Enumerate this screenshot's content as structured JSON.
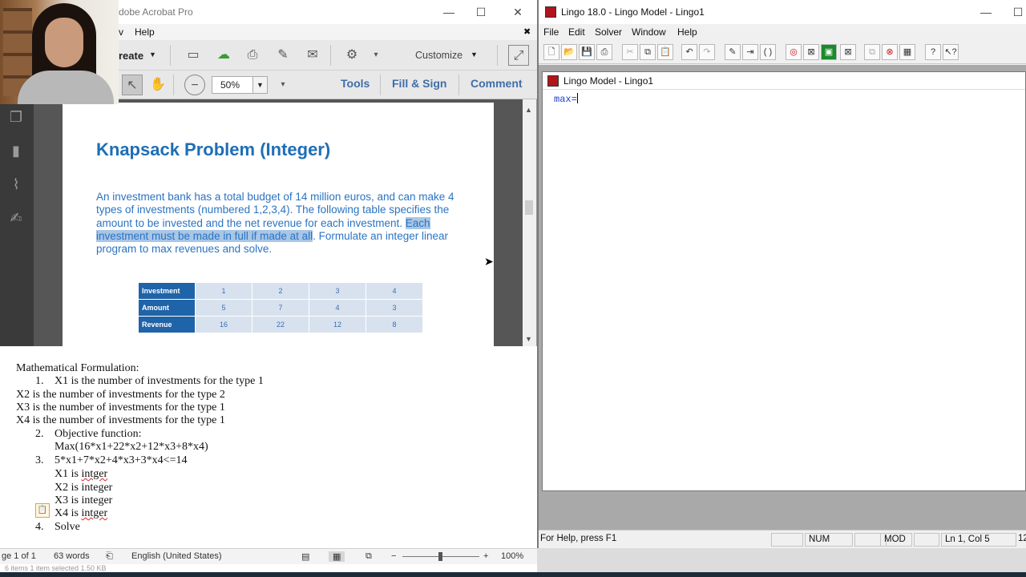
{
  "acrobat": {
    "title": "dobe Acrobat Pro",
    "menu": [
      "v",
      "Help"
    ],
    "toolbar1": {
      "create_label": "reate",
      "customize_label": "Customize"
    },
    "toolbar2": {
      "zoom_value": "50%",
      "tools_label": "Tools",
      "fill_sign_label": "Fill & Sign",
      "comment_label": "Comment"
    },
    "page": {
      "heading": "Knapsack Problem (Integer)",
      "para_before": "An investment bank has a total budget of 14 million euros, and can make 4 types of investments (numbered 1,2,3,4). The following table specifies the amount to be invested and the net revenue for each investment. ",
      "para_highlight": "Each investment must be made in full if made at all",
      "para_after": ". Formulate an integer linear program to max revenues and solve.",
      "table": {
        "rows": [
          {
            "header": "Investment",
            "cells": [
              "1",
              "2",
              "3",
              "4"
            ]
          },
          {
            "header": "Amount",
            "cells": [
              "5",
              "7",
              "4",
              "3"
            ]
          },
          {
            "header": "Revenue",
            "cells": [
              "16",
              "22",
              "12",
              "8"
            ]
          }
        ]
      }
    }
  },
  "word": {
    "lines": [
      "Mathematical Formulation:",
      "1.",
      "X1 is the number of investments for the type 1",
      "X2 is the number of investments for the type 2",
      "X3 is the number of investments for the type 1",
      "X4 is the number of investments for the type 1",
      "2.",
      "Objective function:",
      "Max(16*x1+22*x2+12*x3+8*x4)",
      "3.",
      "5*x1+7*x2+4*x3+3*x4<=14",
      "X1 is ",
      "intger",
      "X2 is integer",
      "X3 is integer",
      "X4 is ",
      "intger",
      "4.",
      "Solve"
    ],
    "status": {
      "page": "ge 1 of 1",
      "words": "63 words",
      "language": "English (United States)",
      "zoom": "100%",
      "minus": "−",
      "plus": "+"
    },
    "explorer_strip": "6 items     1 item selected  1.50 KB"
  },
  "lingo": {
    "title": "Lingo 18.0 - Lingo Model - Lingo1",
    "menu": [
      "File",
      "Edit",
      "Solver",
      "Window",
      "Help"
    ],
    "child_title": "Lingo Model - Lingo1",
    "editor_text": "max=",
    "status": {
      "help": "For Help, press F1",
      "num": "NUM",
      "mod": "MOD",
      "position": "Ln 1, Col 5",
      "extra": "12"
    }
  },
  "colors": {
    "heading_blue": "#1f6eb5",
    "table_header": "#1f63a8",
    "highlight": "#a8c6e6",
    "lingo_icon": "#b2141c"
  }
}
